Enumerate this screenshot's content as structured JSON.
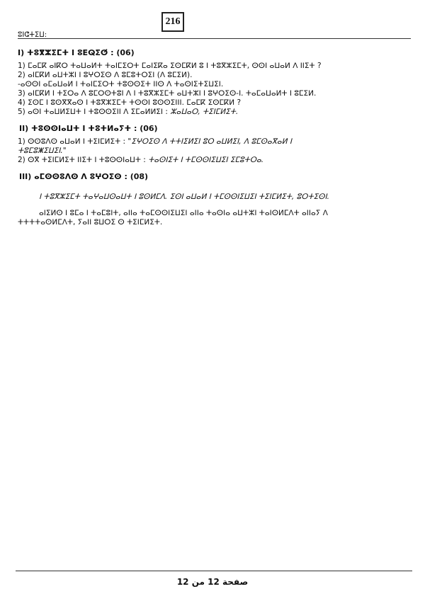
{
  "page_number": "216",
  "header": "ⵓⵏⵛⵜⵉⵡ:",
  "sections": [
    {
      "title": "I) ⵜⵓⴳⵣⵉⵎⵜ ⵏ ⵓⴹⵕⵉⵚ : (06)",
      "lines": [
        {
          "text": "1) ⵎⴰⵎⴽ ⴰⵏⴽⵔ ⵜⴰⵡⴰⵍⵜ ⵜⴰⵏⵎⵉⵔⵜ ⵎⴰⵏⵉⴽⴰ ⵉⵙⵎⴽⵍ ⵓ ⵏ ⵜⵓⴳⵣⵉⵎⵜ, ⵙⵙⵏ ⴰⵡⴰⵍ ⴷ ⵏⵏⵉⵜ ?"
        },
        {
          "text": "2) ⴰⵏⵎⴽⵍ ⴰⵡⵜⵣⵏ ⵏ ⵓⵖⵔⵉⵙ ⴷ ⵓⵎⵓⵜⵔⵉⵏ (ⴷ ⵓⵎⵉⵍ)."
        },
        {
          "text": "-ⴰⵙⵙⵏ ⴰⵎⴰⵡⴰⵍ ⵏ ⵜⴰⵏⵎⵉⵔⵜ ⵜⵓⵙⵙⵉⵜ ⵏⵏⵙ ⴷ ⵜⴰⵙⵏⵉⵜⵉⵡⵉⵏ."
        },
        {
          "text": "3) ⴰⵏⵎⴽⵍ ⵏ ⵜⵉⵔⴰ ⴷ ⵓⵎⵔⵙⵜⵓⵏ ⴷ ⵏ ⵜⵓⴳⵣⵉⵎⵜ ⴰⵡⵜⵣⵏ ⵏ ⵓⵖⵔⵉⵙ-ⵏ. ⵜⴰⵎⴰⵡⴰⵍⵜ ⵏ ⵓⵎⵉⵍ."
        },
        {
          "text": "4) ⵉⵙⵎ ⵏ ⵓⵙⴳⴳⴰⵙ ⵏ ⵜⵓⴳⵣⵉⵎⵜ ⵜⵙⵙⵏ ⵓⵙⵙⵉⵏⵏⵏ. ⵎⴰⵎⴽ ⵉⵙⵎⴽⵍ ?"
        },
        {
          "text": "5) ⴰⵙⵏ ⵜⴰⵡⵍⵉⵡⵜ ⵏ ⵜⵓⵙⵙⵉⵏⵏ ⴷ ⵉⵎⴰⵍⵍⵉⵏ : ",
          "tail": "ⵣⴰⵡⴰⵔ, ⵜⵉⵏⵎⵍⵉⵜ."
        }
      ]
    },
    {
      "title": "II) ⵜⵓⵙⵙⵏⴰⵡⵜ ⵏ ⵜⵓⵜⵍⴰⵢⵜ : (06)",
      "lines": [
        {
          "text": "1) ⵙⵙⵓⴷⵙ ⴰⵡⴰⵍ ⵏ ⵜⵉⵏⵎⵍⵉⵜ : ",
          "tail": "\"ⵉⵖⵔⵉⵙ ⴷ ⵜⵜⵏⵉⵍⵉⵏ ⵓⵔ ⴰⵡⵍⵉⵏ, ⴷ ⵓⵎⵙⴰⴳⴰⵍ ⵏ"
        },
        {
          "text": "",
          "tail": "ⵜⵓⵎⵓⵥⵉⵡⵉⵏ.\"",
          "indent": true
        },
        {
          "text": "2) ⵙⴳ ⵜⵉⵏⵎⵍⵉⵜ ⵏⵏⵉⵜ ⵏ ⵜⵓⵙⵙⵏⴰⵡⵜ : ",
          "tail": "ⵜⴰⵙⵏⵉⵜ ⵏ ⵜⵎⵙⵙⵏⵉⵡⵉⵏ ⵉⵎⵓⵜⵔⴰ."
        }
      ]
    },
    {
      "title": "III) ⴰⵎⵙⵙⵓⴷⵙ ⴷ ⵓⵖⵔⵉⵙ : (08)",
      "paragraphs": [
        "ⵏ ⵜⵓⴳⵣⵉⵎⵜ ⵜⴰⵖⴰⵡⵙⴰⵡⵜ ⵏ ⵓⵙⵍⵎⴷ. ⵉⵙⵏ ⴰⵡⴰⵍ ⵏ ⵜⵎⵙⵙⵏⵉⵡⵉⵏ ⵜⵉⵏⵎⵍⵉⵜ, ⵓⵔⵜⵉⵙⵏ.",
        "ⴰⵏⵉⵍⵙ ⵏ ⵓⵎⴰ ⵏ ⵜⴰⵎⵓⵏⵜ, ⴰⵏⵏⴰ ⵜⴰⵎⵙⵙⵏⵉⵡⵉⵏ ⴰⵏⵏⴰ ⵜⴰⵙⵏⴰ ⴰⵡⵜⵣⵏ ⵜⴰⵏⵙⵍⵎⴷⵜ ⴰⵏⵏⴰⵢ ⴷ",
        "ⵜⵜⵜⵜⴰⵙⵍⵎⴷⵜ, ⵢⴰⵏⵏ ⵓⵡⵔⵉ ⵙ ⵜⵉⵏⵎⵍⵉⵜ."
      ]
    }
  ],
  "footer": "صفحة 12 من 12"
}
